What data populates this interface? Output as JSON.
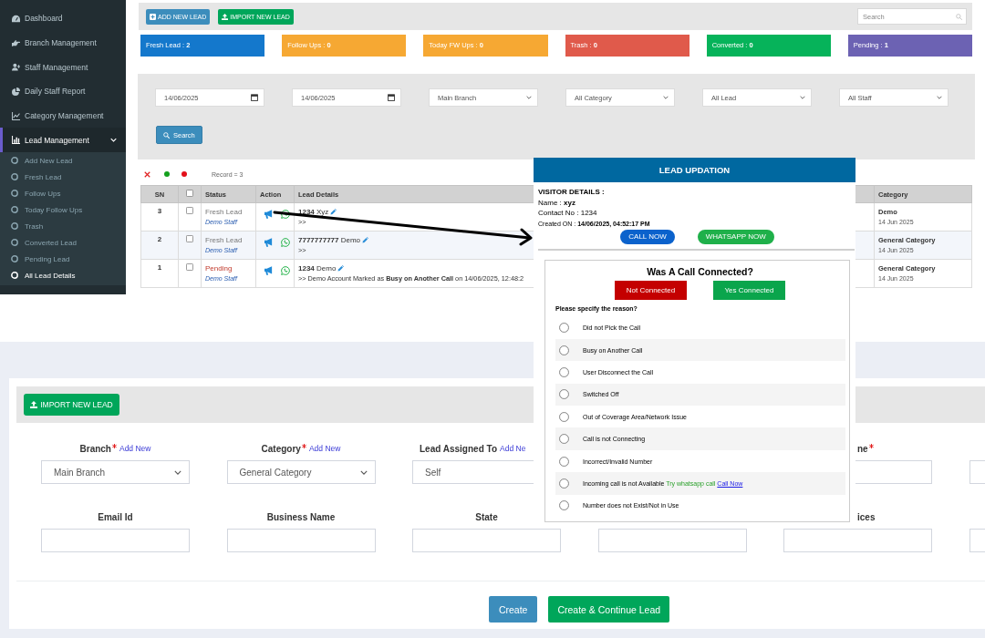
{
  "sidebar": {
    "items": [
      {
        "label": "Dashboard",
        "selected": false
      },
      {
        "label": "Branch Management",
        "selected": false
      },
      {
        "label": "Staff Management",
        "selected": false
      },
      {
        "label": "Daily Staff Report",
        "selected": false
      },
      {
        "label": "Category Management",
        "selected": false
      },
      {
        "label": "Lead Management",
        "selected": true,
        "expanded": true,
        "children": [
          {
            "label": "Add New Lead",
            "selected": false
          },
          {
            "label": "Fresh Lead",
            "selected": false
          },
          {
            "label": "Follow Ups",
            "selected": false
          },
          {
            "label": "Today Follow Ups",
            "selected": false
          },
          {
            "label": "Trash",
            "selected": false
          },
          {
            "label": "Converted Lead",
            "selected": false
          },
          {
            "label": "Pending Lead",
            "selected": false
          },
          {
            "label": "All Lead Details",
            "selected": true
          }
        ]
      }
    ]
  },
  "toolbar": {
    "buttons": [
      {
        "label": "ADD NEW LEAD",
        "kind": "add"
      },
      {
        "label": "IMPORT NEW LEAD",
        "kind": "import"
      }
    ],
    "search": {
      "placeholder": "Search"
    }
  },
  "stat_boxes": [
    {
      "text": "Fresh Lead : **2**",
      "color": "#1478cc"
    },
    {
      "text": "Follow Ups : **0**",
      "color": "#f6a833"
    },
    {
      "text": "Today FW Ups : **0**",
      "color": "#f6a833"
    },
    {
      "text": "Trash : **0**",
      "color": "#e05a4b"
    },
    {
      "text": "Converted : **0**",
      "color": "#06b35a"
    },
    {
      "text": "Pending : **1**",
      "color": "#6c62b3"
    }
  ],
  "filters": {
    "fields": [
      {
        "kind": "date",
        "value": "14/06/2025"
      },
      {
        "kind": "date",
        "value": "14/06/2025"
      },
      {
        "kind": "select",
        "value": "Main Branch"
      },
      {
        "kind": "select",
        "value": "All Category"
      },
      {
        "kind": "select",
        "value": "All Lead"
      },
      {
        "kind": "select",
        "value": "All Staff"
      }
    ],
    "search_button": "Search"
  },
  "legend": {
    "record_count": "Record = 3"
  },
  "table": {
    "columns": [
      {
        "kind": "text",
        "label": "SN"
      },
      {
        "kind": "checkbox",
        "checked": false
      },
      {
        "kind": "text",
        "label": "Status"
      },
      {
        "kind": "text",
        "label": "Action"
      },
      {
        "kind": "text",
        "label": "Lead Details"
      },
      {
        "kind": "text",
        "label": "Category"
      }
    ],
    "rows": [
      {
        "sn": "3",
        "checked": false,
        "status": {
          "label": "Fresh Lead",
          "kind": "fresh"
        },
        "staff": "Demo Staff",
        "lead": "**1234** Xyz",
        "note": ">>",
        "category": "Demo",
        "date": "14 Jun 2025"
      },
      {
        "sn": "2",
        "checked": false,
        "status": {
          "label": "Fresh Lead",
          "kind": "fresh"
        },
        "staff": "Demo Staff",
        "lead": "**7777777777** Demo",
        "note": ">>",
        "category": "General Category",
        "date": "14 Jun 2025"
      },
      {
        "sn": "1",
        "checked": false,
        "status": {
          "label": "Pending",
          "kind": "pending"
        },
        "staff": "Demo Staff",
        "lead": "**1234** Demo",
        "note": ">> Demo Account Marked as **Busy on Another Call** on 14/06/2025, 12:48:2",
        "category": "General Category",
        "date": "14 Jun 2025"
      }
    ]
  },
  "popup": {
    "title": "LEAD UPDATION",
    "visitor_heading": "VISITOR DETAILS :",
    "name_line": "Name : **xyz**",
    "contact_line": "Contact No : 1234",
    "created_line": "Created ON : **14/06/2025, 04:52:17 PM**",
    "actions": [
      {
        "label": "CALL NOW",
        "kind": "call"
      },
      {
        "label": "WHATSAPP NOW",
        "kind": "whatsapp"
      }
    ],
    "question": "Was A Call Connected?",
    "answers": [
      {
        "label": "Not Connected",
        "kind": "no"
      },
      {
        "label": "Yes Connected",
        "kind": "yes"
      }
    ],
    "reason_prompt": "Please specify the reason?",
    "reasons": [
      {
        "label": "Did not Pick the Call",
        "selected": false
      },
      {
        "label": "Busy on Another Call",
        "selected": false
      },
      {
        "label": "User Disconnect the Call",
        "selected": false
      },
      {
        "label": "Switched Off",
        "selected": false
      },
      {
        "label": "Out of Coverage Area/Network Issue",
        "selected": false
      },
      {
        "label": "Call is not Connecting",
        "selected": false
      },
      {
        "label": "Incorrect/Invalid Number",
        "selected": false
      },
      {
        "label": "Incoming call is not Available",
        "hint": "Try whatsapp call",
        "link": "Call Now",
        "selected": false
      },
      {
        "label": "Number does not Exist/Not in Use",
        "selected": false
      }
    ]
  },
  "lead_form": {
    "import_button": "IMPORT NEW LEAD",
    "rows": [
      {
        "fields": [
          {
            "label": "Branch",
            "required": true,
            "add_new": "Add New",
            "kind": "select",
            "value": "Main Branch"
          },
          {
            "label": "Category",
            "required": true,
            "add_new": "Add New",
            "kind": "select",
            "value": "General Category"
          },
          {
            "label": "Lead Assigned To",
            "add_new": "Add Ne",
            "kind": "input",
            "value": "Self"
          },
          {
            "kind": "covered"
          },
          {
            "label": "ne",
            "required": true,
            "kind": "input"
          },
          {
            "kind": "input"
          }
        ]
      },
      {
        "fields": [
          {
            "label": "Email Id",
            "kind": "input"
          },
          {
            "label": "Business Name",
            "kind": "input"
          },
          {
            "label": "State",
            "kind": "input"
          },
          {
            "kind": "input"
          },
          {
            "label": "ices",
            "kind": "input"
          },
          {
            "kind": "input"
          }
        ]
      }
    ],
    "buttons": [
      {
        "label": "Create",
        "kind": "primary"
      },
      {
        "label": "Create & Continue Lead",
        "kind": "success"
      }
    ]
  }
}
